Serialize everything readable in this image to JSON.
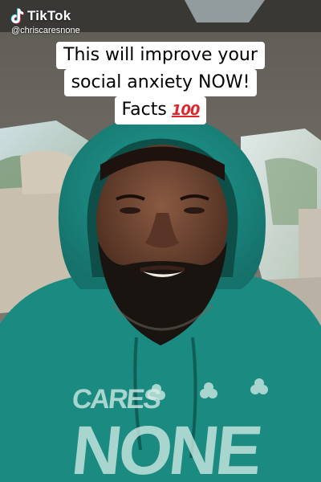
{
  "watermark": {
    "brand": "TikTok",
    "handle": "@chriscaresnone",
    "logo_icon": "tiktok-logo-icon"
  },
  "caption": {
    "line1": "This will improve your",
    "line2": "social anxiety NOW!",
    "line3": "Facts",
    "emoji_icon": "hundred-points-emoji-icon",
    "emoji_text": "100"
  },
  "shirt_print": {
    "top": "CARES",
    "big": "NONE"
  },
  "colors": {
    "hoodie": "#1f8f86",
    "caption_bg": "#ffffff",
    "caption_text": "#000000",
    "emoji_red": "#e0262b"
  }
}
